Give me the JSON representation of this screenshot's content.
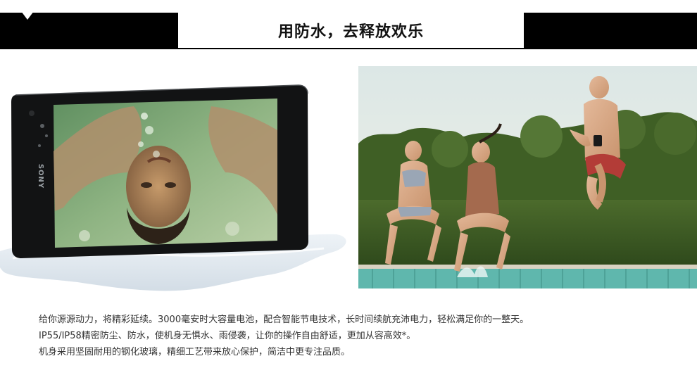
{
  "header": {
    "title": "用防水，去释放欢乐"
  },
  "phone": {
    "brand": "SONY"
  },
  "description": {
    "lines": [
      "给你源源动力，将精彩延续。3000毫安时大容量电池，配合智能节电技术，长时间续航充沛电力，轻松满足你的一整天。",
      "IP55/IP58精密防尘、防水，使机身无惧水、雨侵袭，让你的操作自由舒适，更加从容高效*。",
      "机身采用坚固耐用的钢化玻璃，精细工艺带来放心保护，简洁中更专注品质。"
    ]
  }
}
